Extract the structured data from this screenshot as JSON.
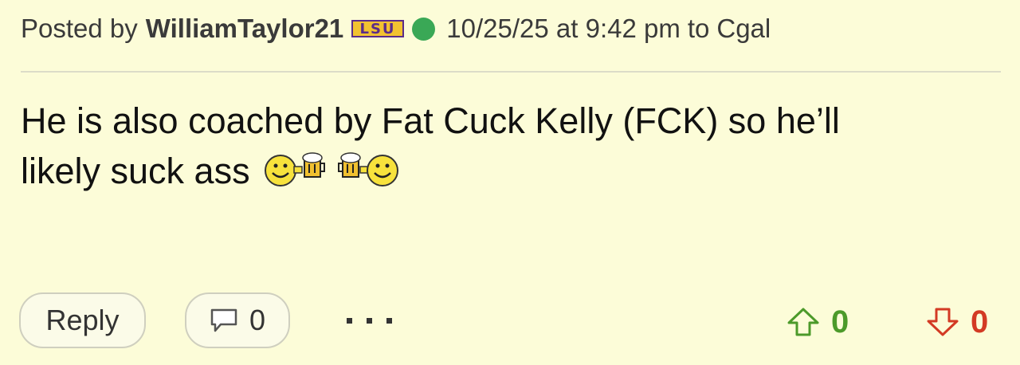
{
  "post": {
    "posted_by_prefix": "Posted by",
    "username": "WilliamTaylor21",
    "team_badge": "LSU",
    "online_status": "online",
    "timestamp": "10/25/25 at 9:42 pm",
    "to_word": "to",
    "recipient": "Cgal",
    "body_line1": "He is also coached by Fat Cuck Kelly (FCK) so he’ll",
    "body_line2": "likely suck ass",
    "emoji": "cheers-emoji"
  },
  "actions": {
    "reply_label": "Reply",
    "comment_count": "0",
    "more_label": "more-options"
  },
  "votes": {
    "upvotes": "0",
    "downvotes": "0"
  },
  "colors": {
    "background": "#fcfcd8",
    "online": "#3aa856",
    "upvote": "#4c9a2a",
    "downvote": "#d33a24",
    "lsu_purple": "#5b2c8a",
    "lsu_gold": "#f2c230"
  }
}
